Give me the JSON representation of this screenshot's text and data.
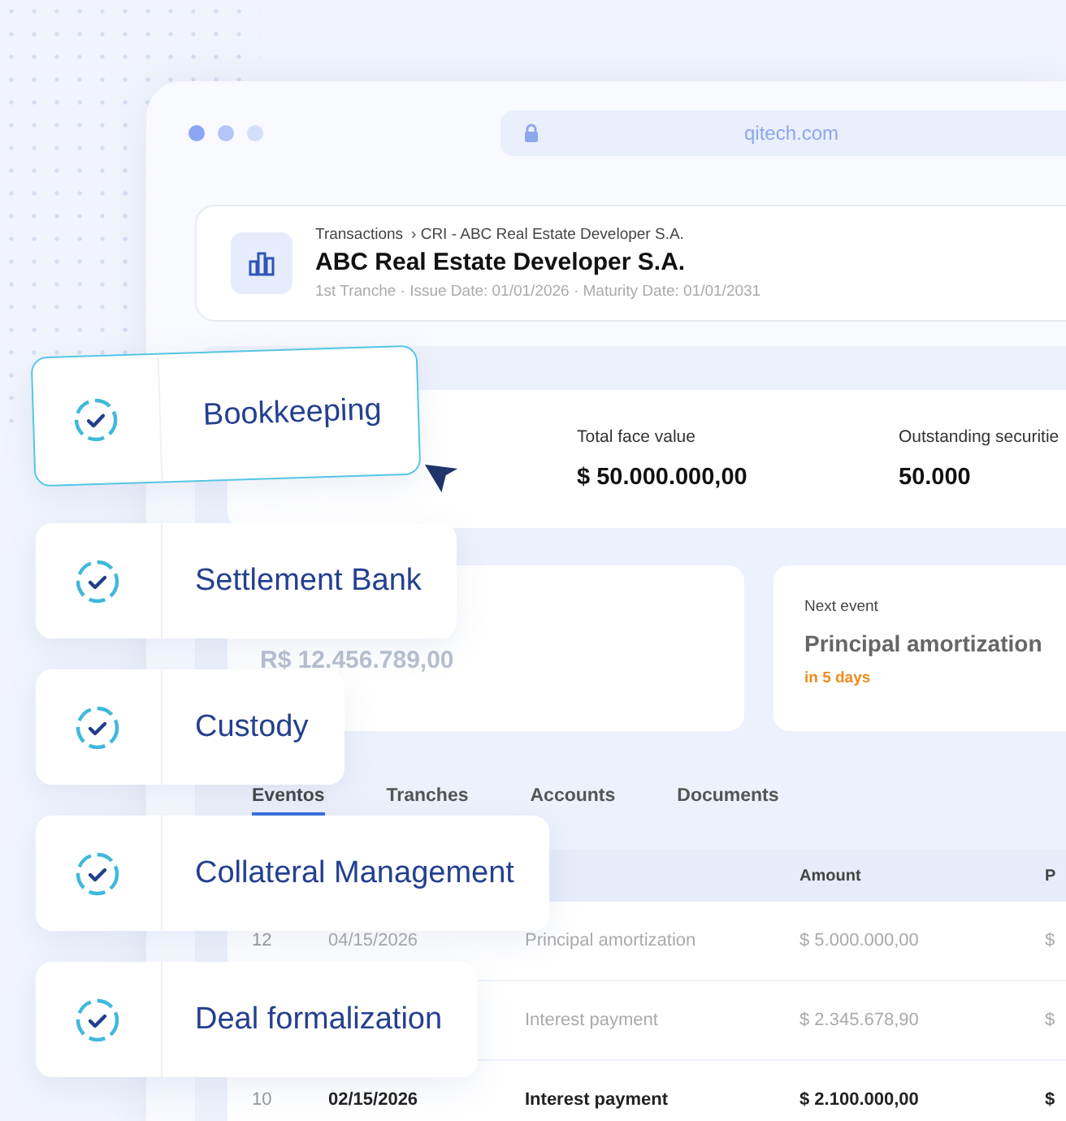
{
  "browser": {
    "url": "qitech.com"
  },
  "header": {
    "breadcrumb_root": "Transactions",
    "breadcrumb_current": "› CRI - ABC Real Estate Developer S.A.",
    "title": "ABC Real Estate Developer S.A.",
    "meta": "1st Tranche · Issue Date: 01/01/2026 · Maturity Date: 01/01/2031"
  },
  "stats": [
    {
      "label": "Total face value",
      "value": "$ 50.000.000,00"
    },
    {
      "label": "Outstanding securitie",
      "value": "50.000"
    }
  ],
  "balance": {
    "value": "R$ 12.456.789,00"
  },
  "next_event": {
    "label": "Next event",
    "title": "Principal amortization",
    "due": "in 5 days"
  },
  "tabs": [
    {
      "label": "Eventos",
      "selected": true
    },
    {
      "label": "Tranches",
      "selected": false
    },
    {
      "label": "Accounts",
      "selected": false
    },
    {
      "label": "Documents",
      "selected": false
    }
  ],
  "table": {
    "headers": {
      "amount": "Amount",
      "column_5": "P"
    },
    "rows": [
      {
        "number": "12",
        "date": "04/15/2026",
        "description": "Principal amortization",
        "amount": "$ 5.000.000,00",
        "column_5": "$",
        "highlighted": false
      },
      {
        "description": "Interest payment",
        "amount": "$ 2.345.678,90",
        "column_5": "$",
        "highlighted": false
      },
      {
        "number": "10",
        "date": "02/15/2026",
        "description": "Interest payment",
        "amount": "$ 2.100.000,00",
        "column_5": "$",
        "highlighted": true
      }
    ]
  },
  "services": [
    {
      "label": "Bookkeeping",
      "selected": true
    },
    {
      "label": "Settlement Bank",
      "selected": false
    },
    {
      "label": "Custody",
      "selected": false
    },
    {
      "label": "Collateral Management",
      "selected": false
    },
    {
      "label": "Deal formalization",
      "selected": false
    }
  ]
}
